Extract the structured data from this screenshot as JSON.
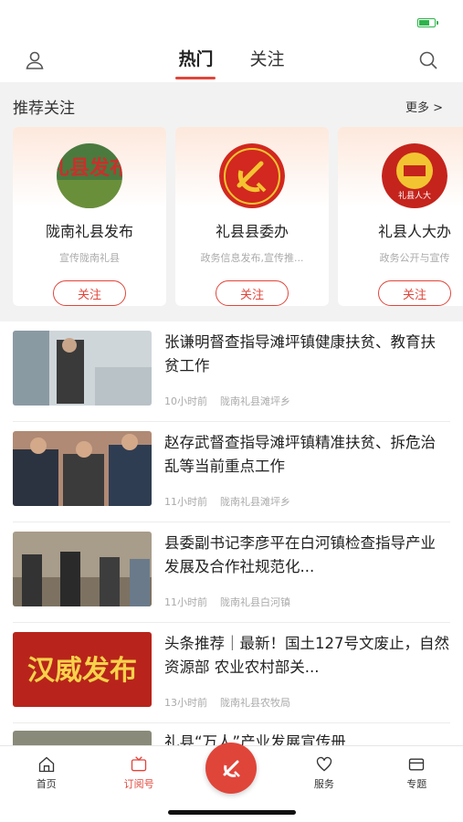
{
  "status": {
    "battery_level": 0.6,
    "battery_color": "#2db34a"
  },
  "header": {
    "tabs": [
      {
        "label": "热门",
        "active": true
      },
      {
        "label": "关注",
        "active": false
      }
    ],
    "icons": {
      "left": "user-icon",
      "right": "search-icon"
    }
  },
  "recommend": {
    "title": "推荐关注",
    "more": "更多 >",
    "cards": [
      {
        "name": "陇南礼县发布",
        "desc": "宣传陇南礼县",
        "button": "关注",
        "logo": "礼县发布"
      },
      {
        "name": "礼县县委办",
        "desc": "政务信息发布,宣传推...",
        "button": "关注",
        "logo": "party-emblem"
      },
      {
        "name": "礼县人大办",
        "desc": "政务公开与宣传",
        "button": "关注",
        "logo": "national-emblem",
        "logo_text": "礼县人大"
      }
    ]
  },
  "feed": [
    {
      "title": "张谦明督查指导滩坪镇健康扶贫、教育扶贫工作",
      "time": "10小时前",
      "source": "陇南礼县滩坪乡"
    },
    {
      "title": "赵存武督查指导滩坪镇精准扶贫、拆危治乱等当前重点工作",
      "time": "11小时前",
      "source": "陇南礼县滩坪乡"
    },
    {
      "title": "县委副书记李彦平在白河镇检查指导产业发展及合作社规范化...",
      "time": "11小时前",
      "source": "陇南礼县白河镇"
    },
    {
      "title": "头条推荐｜最新！国土127号文废止，自然资源部 农业农村部关...",
      "time": "13小时前",
      "source": "陇南礼县农牧局",
      "thumb_text": "汉威发布"
    },
    {
      "title": "礼县“万人”产业发展宣传册"
    }
  ],
  "tabbar": {
    "items": [
      {
        "label": "首页",
        "icon": "home-icon",
        "active": false
      },
      {
        "label": "订阅号",
        "icon": "tv-icon",
        "active": true
      },
      {
        "label": "",
        "icon": "party-emblem-icon",
        "center": true
      },
      {
        "label": "服务",
        "icon": "heart-icon",
        "active": false
      },
      {
        "label": "专题",
        "icon": "card-icon",
        "active": false
      }
    ]
  },
  "colors": {
    "accent": "#e0453a",
    "section_bg": "#f2f2f2"
  }
}
